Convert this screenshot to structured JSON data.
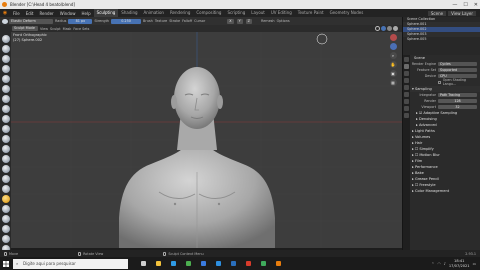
{
  "window": {
    "title": "Blender [C:\\Head 4 beato\\blend]",
    "controls": [
      "—",
      "☐",
      "✕"
    ]
  },
  "menubar": {
    "items": [
      "File",
      "Edit",
      "Render",
      "Window",
      "Help"
    ],
    "workspace_tabs": [
      "Sculpting",
      "Shading",
      "Animation",
      "Rendering",
      "Compositing",
      "Scripting",
      "Layout",
      "UV Editing",
      "Texture Paint",
      "Geometry Nodes"
    ],
    "active_tab": "Sculpting",
    "scene": "Scene",
    "view_layer": "View Layer"
  },
  "toolheader": {
    "brush": "Elastic Deform",
    "radius_label": "Radius",
    "radius": "81 px",
    "strength_label": "Strength",
    "strength": "0.250",
    "brush_menu": "Brush",
    "texture_menu": "Texture",
    "stroke_menu": "Stroke",
    "falloff_menu": "Falloff",
    "cursor_menu": "Cursor",
    "remesh_label": "Remesh",
    "options_label": "Options"
  },
  "vpheader": {
    "mode": "Sculpt Mode",
    "menus": [
      "View",
      "Sculpt",
      "Mask",
      "Face Sets"
    ]
  },
  "viewport": {
    "view_name": "Front Orthographic",
    "object_name": "(27) Sphere.002"
  },
  "outliner": {
    "rows": [
      {
        "label": "Scene Collection",
        "selected": false
      },
      {
        "label": "Sphere.001",
        "selected": false
      },
      {
        "label": "Sphere.002",
        "selected": true
      },
      {
        "label": "Sphere.003",
        "selected": false
      },
      {
        "label": "Sphere.005",
        "selected": false
      }
    ]
  },
  "properties": {
    "scene_label": "Scene",
    "render_engine_label": "Render Engine",
    "render_engine": "Cycles",
    "feature_set_label": "Feature Set",
    "feature_set": "Supported",
    "device_label": "Device",
    "device": "CPU",
    "open_shading_label": "Open Shading Langu...",
    "sampling_label": "Sampling",
    "integrator_label": "Integrator",
    "integrator": "Path Tracing",
    "render_label": "Render",
    "render_samples": "128",
    "viewport_label": "Viewport",
    "viewport_samples": "32",
    "adaptive_label": "Adaptive Sampling",
    "denoising_label": "Denoising",
    "advanced_label": "Advanced",
    "sections": [
      "Light Paths",
      "Volumes",
      "Hair",
      "Simplify",
      "Motion Blur",
      "Film",
      "Performance",
      "Bake",
      "Grease Pencil",
      "Freestyle",
      "Color Management"
    ]
  },
  "statusbar": {
    "left1": "Move",
    "left2": "Rotate View",
    "left3": "Sculpt Context Menu",
    "version": "2.93.1"
  },
  "taskbar": {
    "search_placeholder": "Digite aqui para pesquisar",
    "time": "18:41",
    "date": "17/07/2021",
    "apps": [
      {
        "icon": "task-view-icon",
        "color": "#cfcfcf"
      },
      {
        "icon": "file-explorer-icon",
        "color": "#f3c23c"
      },
      {
        "icon": "edge-icon",
        "color": "#2f9be6"
      },
      {
        "icon": "chrome-icon",
        "color": "#4caf50"
      },
      {
        "icon": "store-icon",
        "color": "#3a7be0"
      },
      {
        "icon": "mail-icon",
        "color": "#2d8fe0"
      },
      {
        "icon": "photoshop-icon",
        "color": "#2a6fbd"
      },
      {
        "icon": "app-red-icon",
        "color": "#d83b2b"
      },
      {
        "icon": "app-green-icon",
        "color": "#3faa5c"
      },
      {
        "icon": "blender-icon",
        "color": "#e87d0d"
      }
    ]
  },
  "colors": {
    "accent": "#4772b3",
    "viewport_bg": "#3d3d3d",
    "blender_orange": "#e87d0d"
  }
}
